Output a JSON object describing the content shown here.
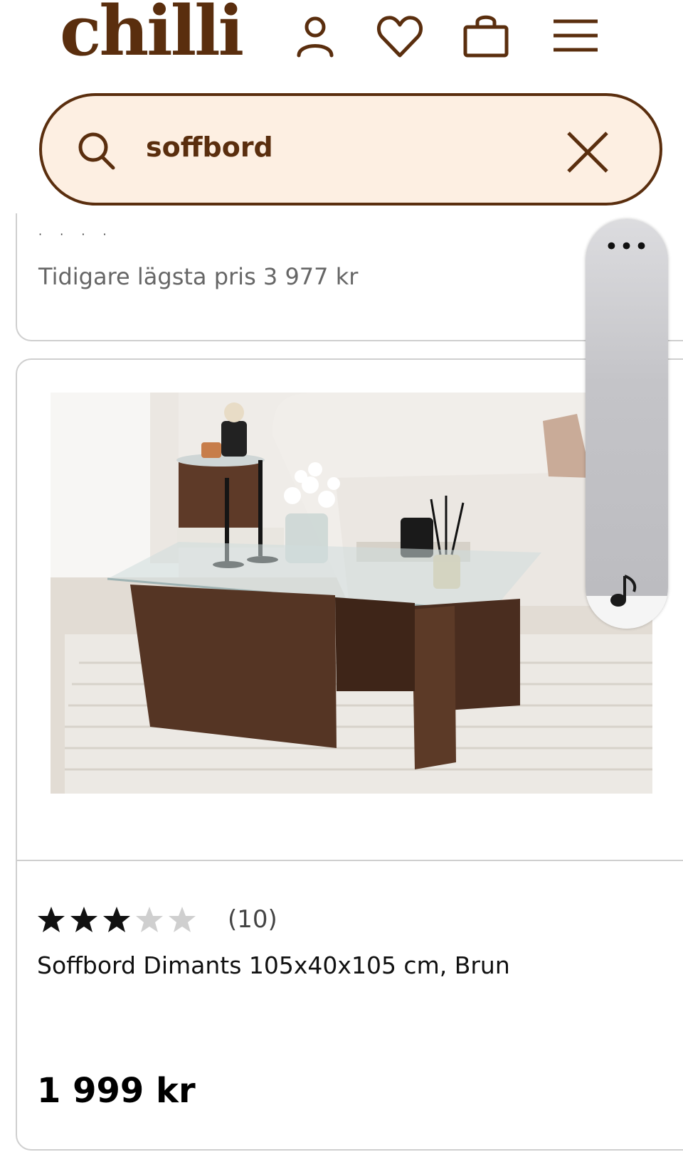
{
  "header": {
    "logo": "chilli",
    "icons": [
      "user-icon",
      "heart-icon",
      "bag-icon",
      "menu-icon"
    ]
  },
  "search": {
    "value": "soffbord",
    "icons": [
      "search-icon",
      "close-icon"
    ]
  },
  "previous_card": {
    "truncated_text": "·   · ·           ·",
    "previous_lowest_price": "Tidigare lägsta pris 3 977 kr"
  },
  "product": {
    "rating": 3,
    "rating_max": 5,
    "review_count": "(10)",
    "title": "Soffbord Dimants 105x40x105 cm, Brun",
    "price": "1 999 kr"
  },
  "floating_widget": {
    "more_label": "•••",
    "icon": "music-note-icon"
  },
  "colors": {
    "brand": "#5a2e0e",
    "search_bg": "#fdefe2",
    "star_filled": "#111111",
    "star_empty": "#cfcfcf"
  }
}
